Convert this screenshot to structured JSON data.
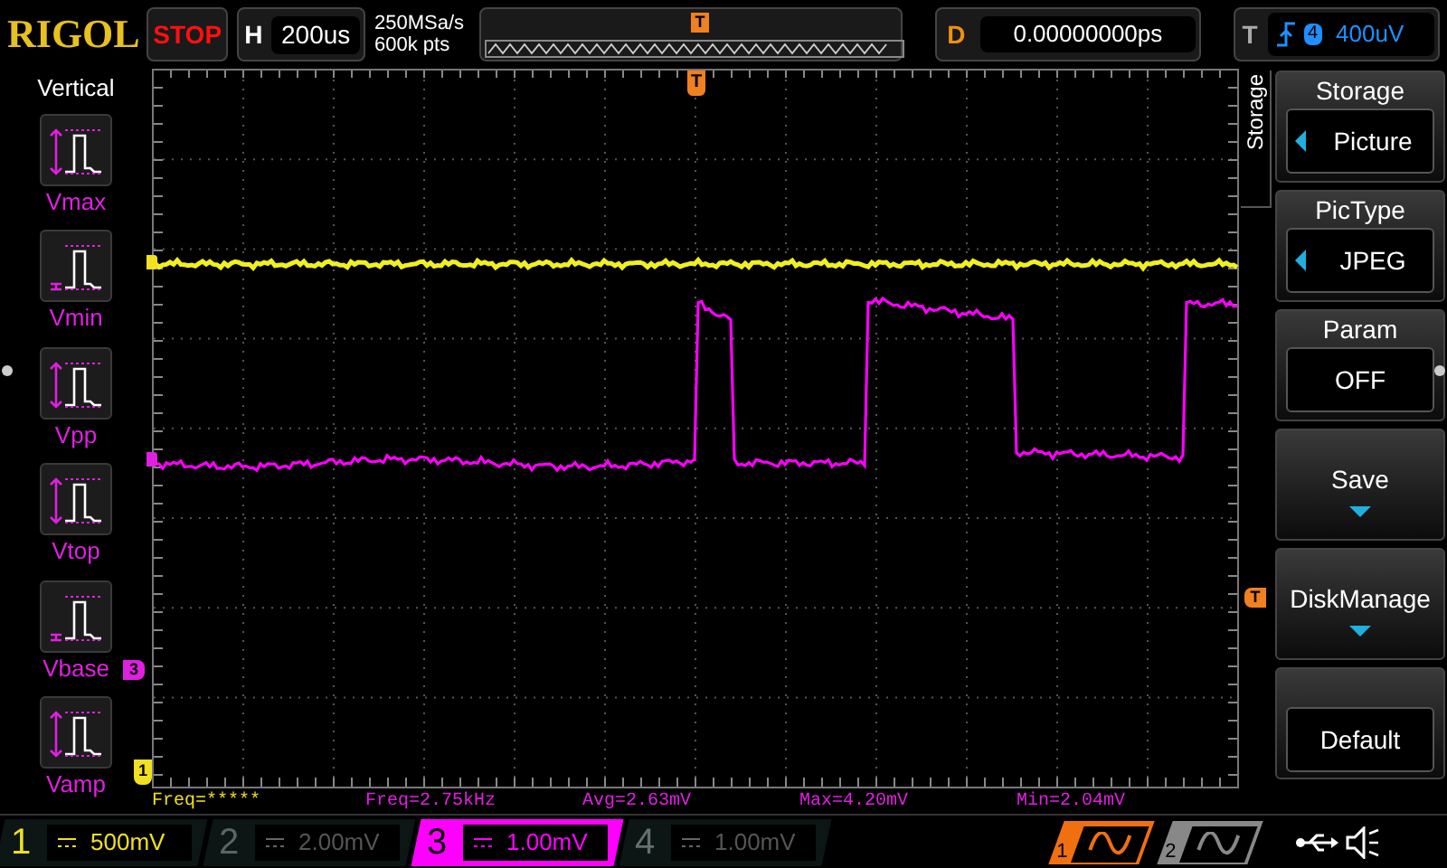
{
  "header": {
    "brand": "RIGOL",
    "run_state": "STOP",
    "horizontal": {
      "label": "H",
      "value": "200us"
    },
    "sampling": {
      "rate": "250MSa/s",
      "depth": "600k pts"
    },
    "overview_marker": "T",
    "delay": {
      "label": "D",
      "value": "0.00000000ps"
    },
    "trigger": {
      "label": "T",
      "source": "4",
      "level": "400uV"
    }
  },
  "left_panel": {
    "title": "Vertical",
    "items": [
      {
        "label": "Vmax",
        "kind": "max"
      },
      {
        "label": "Vmin",
        "kind": "min"
      },
      {
        "label": "Vpp",
        "kind": "pp"
      },
      {
        "label": "Vtop",
        "kind": "top"
      },
      {
        "label": "Vbase",
        "kind": "base"
      },
      {
        "label": "Vamp",
        "kind": "amp"
      }
    ]
  },
  "markers": {
    "trigger_position": "T",
    "trigger_level": "T",
    "channel_3": "3",
    "channel_1": "1"
  },
  "measurements": [
    {
      "text": "Freq=*****",
      "color": "#f0e020"
    },
    {
      "text": "Freq=2.75kHz",
      "color": "#e020e0"
    },
    {
      "text": "Avg=2.63mV",
      "color": "#e020e0"
    },
    {
      "text": "Max=4.20mV",
      "color": "#e020e0"
    },
    {
      "text": "Min=2.04mV",
      "color": "#e020e0"
    }
  ],
  "menu": {
    "title": "Storage",
    "items": [
      {
        "kind": "choice",
        "title": "Storage",
        "value": "Picture"
      },
      {
        "kind": "choice",
        "title": "PicType",
        "value": "JPEG"
      },
      {
        "kind": "toggle",
        "title": "Param",
        "value": "OFF"
      },
      {
        "kind": "submenu",
        "title": "Save"
      },
      {
        "kind": "submenu",
        "title": "DiskManage"
      },
      {
        "kind": "action",
        "title": "Default"
      }
    ]
  },
  "channels": [
    {
      "number": "1",
      "scale": "500mV",
      "color": "#f0e020",
      "on": true,
      "selected": false
    },
    {
      "number": "2",
      "scale": "2.00mV",
      "color": "#5a6666",
      "on": false,
      "selected": false
    },
    {
      "number": "3",
      "scale": "1.00mV",
      "color": "#ff00ff",
      "on": true,
      "selected": true
    },
    {
      "number": "4",
      "scale": "1.00mV",
      "color": "#667070",
      "on": false,
      "selected": false
    }
  ],
  "generators": [
    {
      "number": "1",
      "on": true
    },
    {
      "number": "2",
      "on": false
    }
  ]
}
